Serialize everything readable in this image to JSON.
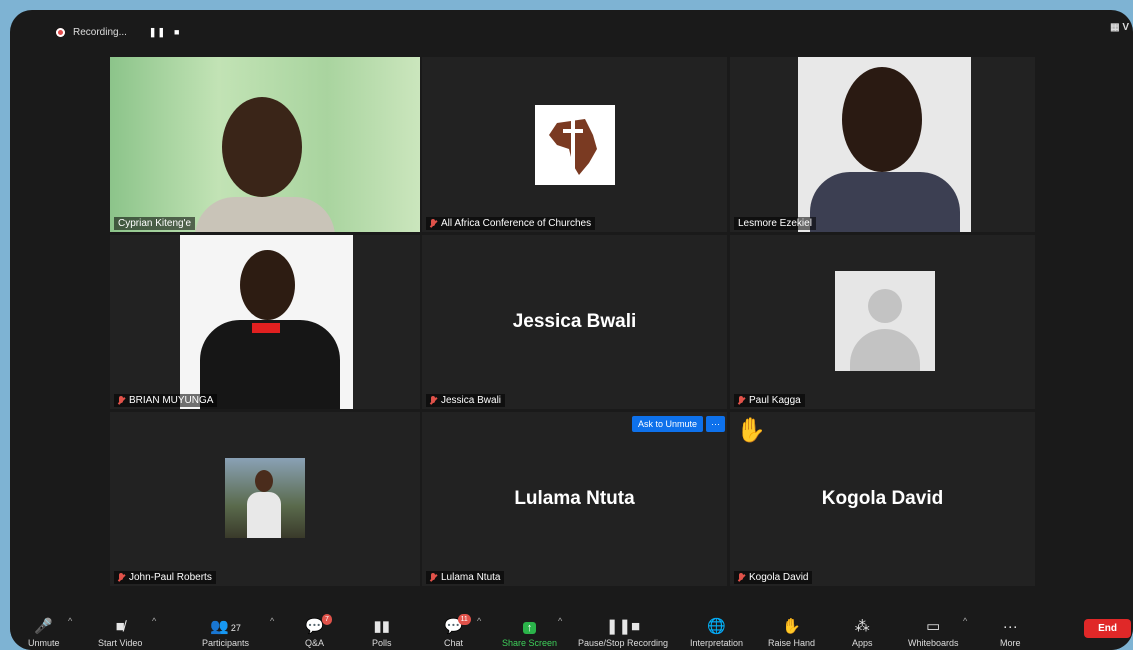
{
  "recording": {
    "label": "Recording...",
    "pause": "❚❚",
    "stop": "■"
  },
  "view": "▦ V",
  "tiles": [
    {
      "name": "Cyprian Kiteng'e"
    },
    {
      "name": "All Africa Conference of Churches"
    },
    {
      "name": "Lesmore Ezekiel"
    },
    {
      "name": "BRIAN MUYUNGA"
    },
    {
      "name": "Jessica Bwali",
      "big": "Jessica Bwali"
    },
    {
      "name": "Paul Kagga"
    },
    {
      "name": "John-Paul Roberts"
    },
    {
      "name": "Lulama Ntuta",
      "big": "Lulama Ntuta",
      "ask": "Ask to Unmute",
      "more": "···"
    },
    {
      "name": "Kogola David",
      "big": "Kogola David",
      "hand": "✋"
    }
  ],
  "toolbar": {
    "unmute": "Unmute",
    "start_video": "Start Video",
    "participants": "Participants",
    "participants_count": "27",
    "qa": "Q&A",
    "qa_badge": "7",
    "polls": "Polls",
    "chat": "Chat",
    "chat_badge": "11",
    "share": "Share Screen",
    "recording": "Pause/Stop Recording",
    "interpretation": "Interpretation",
    "raise_hand": "Raise Hand",
    "apps": "Apps",
    "whiteboards": "Whiteboards",
    "more": "More",
    "end": "End"
  }
}
